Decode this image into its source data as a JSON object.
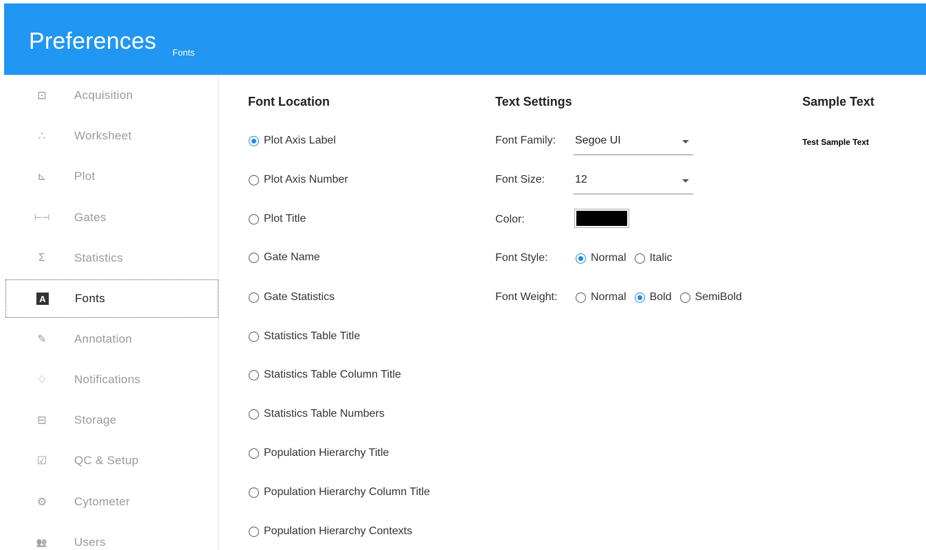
{
  "header": {
    "title": "Preferences",
    "subtitle": "Fonts"
  },
  "sidebar": {
    "items": [
      {
        "label": "Acquisition",
        "icon": "acquisition-icon",
        "glyph": "⊡"
      },
      {
        "label": "Worksheet",
        "icon": "worksheet-icon",
        "glyph": "∴"
      },
      {
        "label": "Plot",
        "icon": "plot-icon",
        "glyph": "⊾"
      },
      {
        "label": "Gates",
        "icon": "gates-icon",
        "glyph": "⊢⊣"
      },
      {
        "label": "Statistics",
        "icon": "sigma-icon",
        "glyph": "Σ"
      },
      {
        "label": "Fonts",
        "icon": "fonts-icon",
        "glyph": "A"
      },
      {
        "label": "Annotation",
        "icon": "edit-icon",
        "glyph": "✎"
      },
      {
        "label": "Notifications",
        "icon": "bell-icon",
        "glyph": "♢"
      },
      {
        "label": "Storage",
        "icon": "drive-icon",
        "glyph": "⊟"
      },
      {
        "label": "QC & Setup",
        "icon": "qc-setup-icon",
        "glyph": "☑"
      },
      {
        "label": "Cytometer",
        "icon": "cytometer-icon",
        "glyph": "⚙"
      },
      {
        "label": "Users",
        "icon": "users-icon",
        "glyph": "👥"
      }
    ],
    "active": "Fonts"
  },
  "font_location": {
    "heading": "Font Location",
    "options": [
      "Plot Axis Label",
      "Plot Axis Number",
      "Plot Title",
      "Gate Name",
      "Gate Statistics",
      "Statistics Table Title",
      "Statistics Table Column Title",
      "Statistics Table Numbers",
      "Population Hierarchy Title",
      "Population Hierarchy Column Title",
      "Population Hierarchy Contexts"
    ],
    "selected": "Plot Axis Label"
  },
  "text_settings": {
    "heading": "Text Settings",
    "font_family_label": "Font Family:",
    "font_family_value": "Segoe UI",
    "font_size_label": "Font Size:",
    "font_size_value": "12",
    "color_label": "Color:",
    "color_value": "#000000",
    "font_style_label": "Font Style:",
    "font_style_options": [
      "Normal",
      "Italic"
    ],
    "font_style_selected": "Normal",
    "font_weight_label": "Font Weight:",
    "font_weight_options": [
      "Normal",
      "Bold",
      "SemiBold"
    ],
    "font_weight_selected": "Bold"
  },
  "sample": {
    "heading": "Sample Text",
    "text": "Test Sample Text"
  },
  "colors": {
    "header": "#2196f3",
    "accent": "#1e88e5"
  }
}
